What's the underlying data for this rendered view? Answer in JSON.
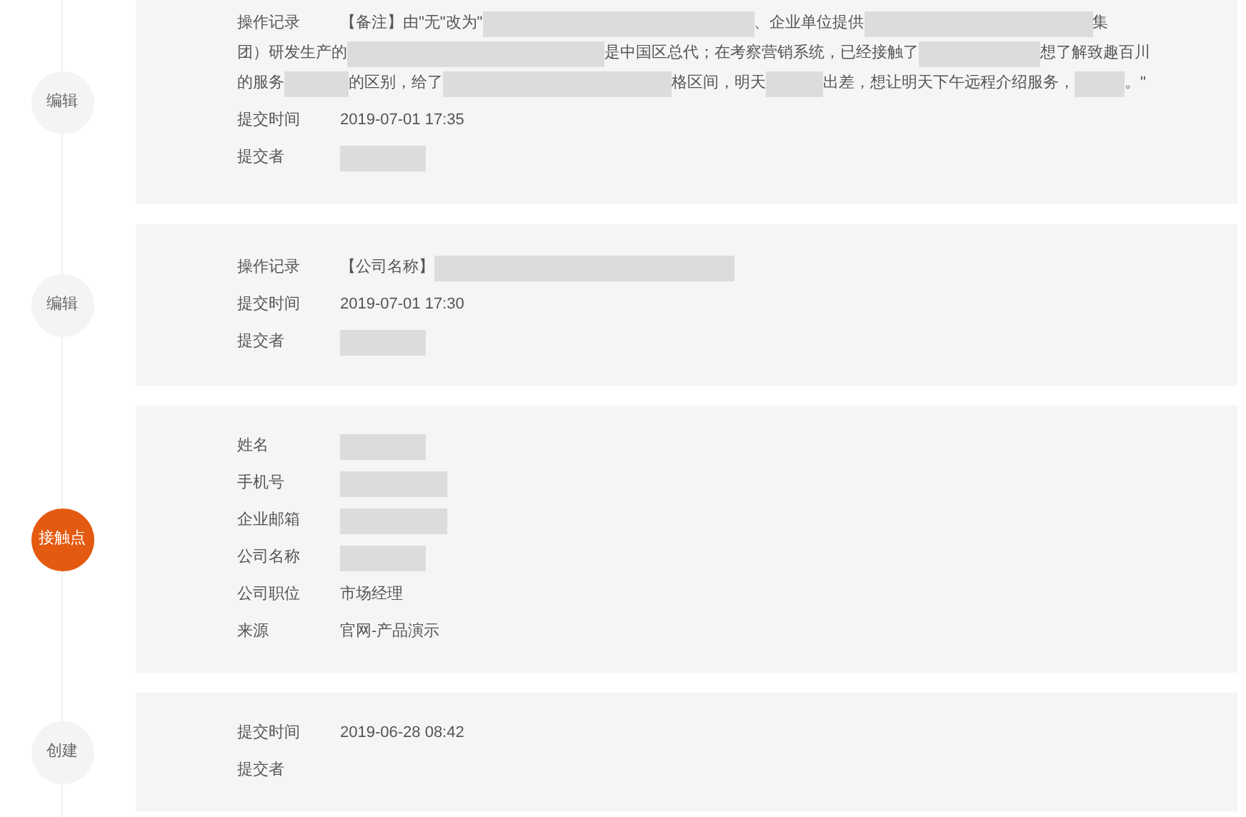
{
  "timeline": [
    {
      "node": {
        "label": "编辑",
        "highlighted": false
      },
      "fields": [
        {
          "label": "操作记录",
          "kind": "paragraph",
          "lines": [
            [
              {
                "kind": "text",
                "text": "【备注】由\"无\"改为\""
              },
              {
                "kind": "redacted"
              },
              {
                "kind": "text",
                "text": "、企业单位提供"
              },
              {
                "kind": "redacted"
              },
              {
                "kind": "text",
                "text": "集"
              }
            ],
            [
              {
                "kind": "text",
                "text": "团）研发生产的"
              },
              {
                "kind": "redacted"
              },
              {
                "kind": "text",
                "text": "是中国区总代；在考察营销系统，已经接触了"
              },
              {
                "kind": "redacted"
              },
              {
                "kind": "text",
                "text": "想了解致趣百川"
              }
            ],
            [
              {
                "kind": "text",
                "text": "的服务"
              },
              {
                "kind": "redacted"
              },
              {
                "kind": "text",
                "text": "的区别，给了"
              },
              {
                "kind": "redacted"
              },
              {
                "kind": "text",
                "text": "格区间，明天"
              },
              {
                "kind": "redacted"
              },
              {
                "kind": "text",
                "text": "出差，想让明天下午远程介绍服务，"
              },
              {
                "kind": "redacted"
              },
              {
                "kind": "text",
                "text": "。\""
              }
            ]
          ]
        },
        {
          "label": "提交时间",
          "kind": "line",
          "value": [
            {
              "kind": "text",
              "text": "2019-07-01 17:35"
            }
          ]
        },
        {
          "label": "提交者",
          "kind": "line",
          "value": [
            {
              "kind": "redacted"
            }
          ]
        }
      ]
    },
    {
      "node": {
        "label": "编辑",
        "highlighted": false
      },
      "fields": [
        {
          "label": "操作记录",
          "kind": "line",
          "value": [
            {
              "kind": "text",
              "text": "【公司名称】"
            },
            {
              "kind": "redacted"
            }
          ]
        },
        {
          "label": "提交时间",
          "kind": "line",
          "value": [
            {
              "kind": "text",
              "text": "2019-07-01 17:30"
            }
          ]
        },
        {
          "label": "提交者",
          "kind": "line",
          "value": [
            {
              "kind": "redacted"
            }
          ]
        }
      ]
    },
    {
      "node": {
        "label": "接触点",
        "highlighted": true
      },
      "fields": [
        {
          "label": "姓名",
          "kind": "line",
          "value": [
            {
              "kind": "redacted"
            }
          ]
        },
        {
          "label": "手机号",
          "kind": "line",
          "value": [
            {
              "kind": "redacted"
            }
          ]
        },
        {
          "label": "企业邮箱",
          "kind": "line",
          "value": [
            {
              "kind": "redacted"
            }
          ]
        },
        {
          "label": "公司名称",
          "kind": "line",
          "value": [
            {
              "kind": "redacted"
            }
          ]
        },
        {
          "label": "公司职位",
          "kind": "line",
          "value": [
            {
              "kind": "text",
              "text": "市场经理"
            }
          ]
        },
        {
          "label": "来源",
          "kind": "line",
          "value": [
            {
              "kind": "text",
              "text": "官网-产品演示"
            }
          ]
        }
      ]
    },
    {
      "node": {
        "label": "创建",
        "highlighted": false
      },
      "fields": [
        {
          "label": "提交时间",
          "kind": "line",
          "value": [
            {
              "kind": "text",
              "text": "2019-06-28 08:42"
            }
          ]
        },
        {
          "label": "提交者",
          "kind": "line"
        }
      ]
    }
  ]
}
